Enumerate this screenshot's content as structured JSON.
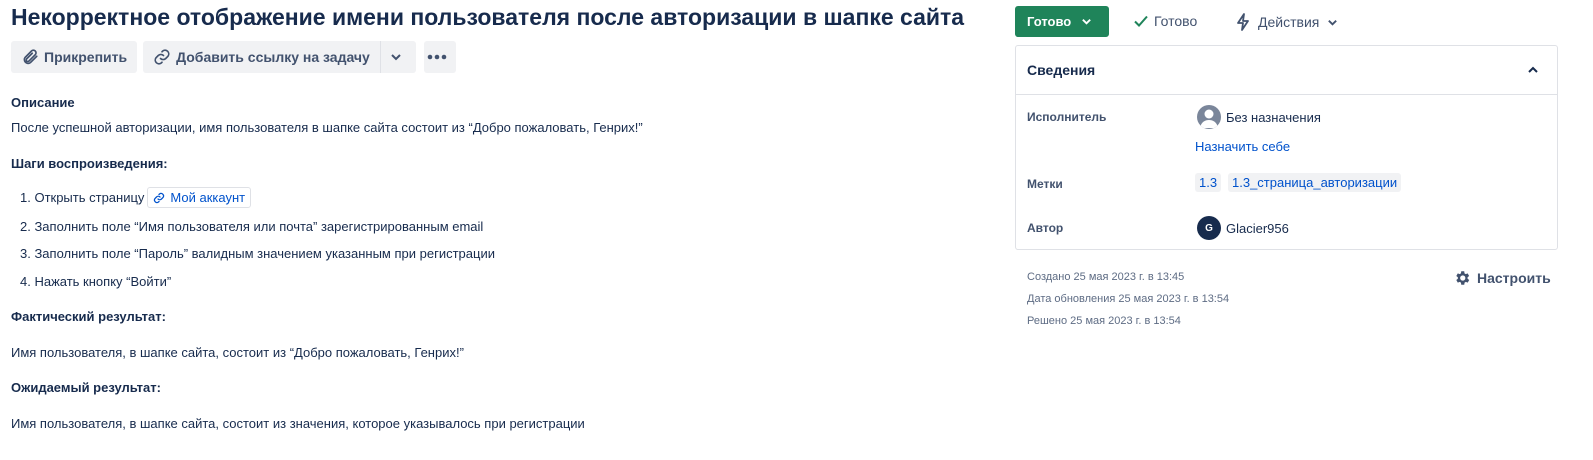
{
  "issue": {
    "title": "Некорректное отображение имени пользователя после авторизации в шапке сайта"
  },
  "toolbar": {
    "attach_label": "Прикрепить",
    "add_link_label": "Добавить ссылку на задачу"
  },
  "description": {
    "heading": "Описание",
    "summary": "После успешной авторизации, имя пользователя в шапке сайта состоит из “Добро пожаловать, Генрих!”",
    "steps_heading": "Шаги воспроизведения:",
    "steps": [
      {
        "text": "1. Открыть страницу",
        "link": "Мой аккаунт"
      },
      {
        "text": "2. Заполнить поле “Имя пользователя или почта” зарегистрированным email"
      },
      {
        "text": "3. Заполнить поле “Пароль” валидным значением указанным при регистрации"
      },
      {
        "text": "4. Нажать кнопку “Войти”"
      }
    ],
    "actual_heading": "Фактический результат:",
    "actual_text": "Имя пользователя, в шапке сайта, состоит из “Добро пожаловать, Генрих!”",
    "expected_heading": "Ожидаемый результат:",
    "expected_text": "Имя пользователя, в шапке сайта, состоит из значения, которое указывалось при регистрации"
  },
  "status": {
    "button_label": "Готово",
    "resolution_label": "Готово",
    "actions_label": "Действия",
    "button_color": "#1f845a"
  },
  "details": {
    "heading": "Сведения",
    "assignee_label": "Исполнитель",
    "assignee_value": "Без назначения",
    "assign_to_me": "Назначить себе",
    "labels_label": "Метки",
    "labels": [
      "1.3",
      "1.3_страница_авторизации"
    ],
    "author_label": "Автор",
    "author_initial": "G",
    "author_name": "Glacier956"
  },
  "dates": {
    "created": "Создано 25 мая 2023 г. в 13:45",
    "updated": "Дата обновления 25 мая 2023 г. в 13:54",
    "resolved": "Решено 25 мая 2023 г. в 13:54"
  },
  "configure_label": "Настроить"
}
